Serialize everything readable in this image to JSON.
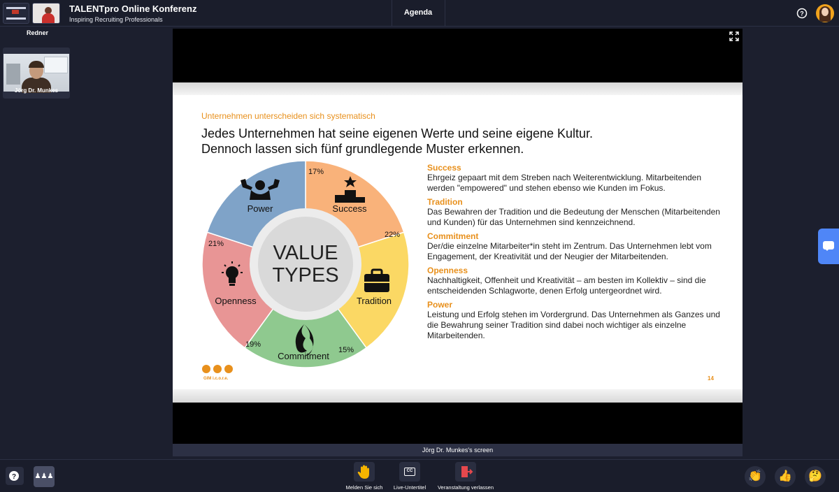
{
  "header": {
    "title": "TALENTpro Online Konferenz",
    "subtitle": "Inspiring Recruiting Professionals",
    "agenda_tab": "Agenda"
  },
  "sidebar": {
    "section_label": "Redner",
    "speaker_name": "Jörg Dr. Munkes"
  },
  "share": {
    "caption": "Jörg Dr. Munkes's screen"
  },
  "slide": {
    "kicker": "Unternehmen unterscheiden sich systematisch",
    "title_line1": "Jedes Unternehmen hat seine eigenen Werte und seine eigene Kultur.",
    "title_line2": "Dennoch lassen sich fünf grundlegende Muster erkennen.",
    "wheel": {
      "center_line1": "VALUE",
      "center_line2": "TYPES",
      "segments": [
        {
          "label": "Success",
          "percent": "17%",
          "color": "#f9b27a",
          "icon": "podium-star-icon"
        },
        {
          "label": "Tradition",
          "percent": "22%",
          "color": "#fbd864",
          "icon": "briefcase-icon"
        },
        {
          "label": "Commitment",
          "percent": "15%",
          "color": "#8fc98f",
          "icon": "flame-icon"
        },
        {
          "label": "Openness",
          "percent": "19%",
          "color": "#e89595",
          "icon": "lightbulb-icon"
        },
        {
          "label": "Power",
          "percent": "21%",
          "color": "#7fa3c8",
          "icon": "flexing-muscles-icon"
        }
      ]
    },
    "descriptions": [
      {
        "title": "Success",
        "text": "Ehrgeiz gepaart mit dem Streben nach Weiterentwicklung. Mitarbeitenden werden \"empowered\" und stehen ebenso wie Kunden im Fokus."
      },
      {
        "title": "Tradition",
        "text": "Das Bewahren der Tradition und die Bedeutung der Menschen (Mitarbeitenden und Kunden) für das Unternehmen sind kennzeichnend."
      },
      {
        "title": "Commitment",
        "text": "Der/die einzelne Mitarbeiter*in steht im Zentrum. Das Unternehmen lebt vom Engagement, der Kreativität und der Neugier der Mitarbeitenden."
      },
      {
        "title": "Openness",
        "text": "Nachhaltigkeit, Offenheit und Kreativität – am besten im Kollektiv – sind die entscheidenden Schlagworte, denen Erfolg untergeordnet wird."
      },
      {
        "title": "Power",
        "text": "Leistung und Erfolg stehen im Vordergrund. Das Unternehmen als Ganzes und die Bewahrung seiner Tradition sind dabei noch wichtiger als einzelne Mitarbeitenden."
      }
    ],
    "logo_text": "GIM i.c.o.r.e.",
    "page_number": "14"
  },
  "bottom": {
    "raise_hand": "Melden Sie sich",
    "captions": "Live-Untertitel",
    "leave": "Veranstaltung verlassen",
    "cc_glyph": "CC",
    "people_glyph": "♟♟♟"
  },
  "colors": {
    "accent_orange": "#e8901c",
    "app_background": "#1c1f2e",
    "chat_tab": "#4f86f7"
  }
}
